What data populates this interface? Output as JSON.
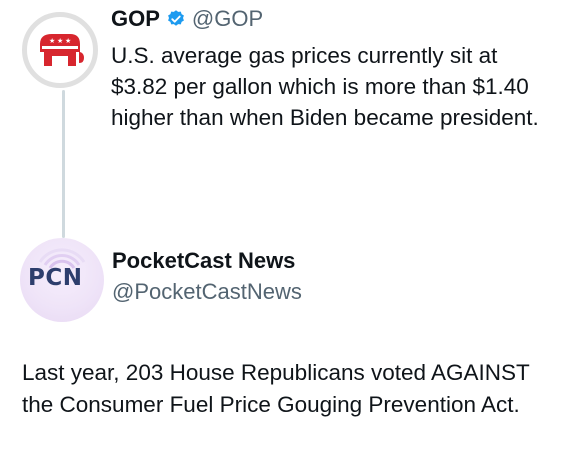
{
  "tweet": {
    "display_name": "GOP",
    "handle": "@GOP",
    "text": "U.S. average gas prices currently sit at $3.82 per gallon which is more than $1.40 higher than when Biden became president."
  },
  "reply": {
    "display_name": "PocketCast News",
    "handle": "@PocketCastNews",
    "avatar_text": "PCN",
    "text": "Last year, 203 House Republicans voted AGAINST the Consumer Fuel Price Gouging Prevention Act."
  },
  "colors": {
    "gop_red": "#d7262e",
    "verified_blue": "#1d9bf0",
    "handle_gray": "#536471",
    "pcn_navy": "#2d3e6d"
  },
  "icons": {
    "gop_avatar": "republican-elephant-icon",
    "verified": "verified-badge-icon"
  }
}
